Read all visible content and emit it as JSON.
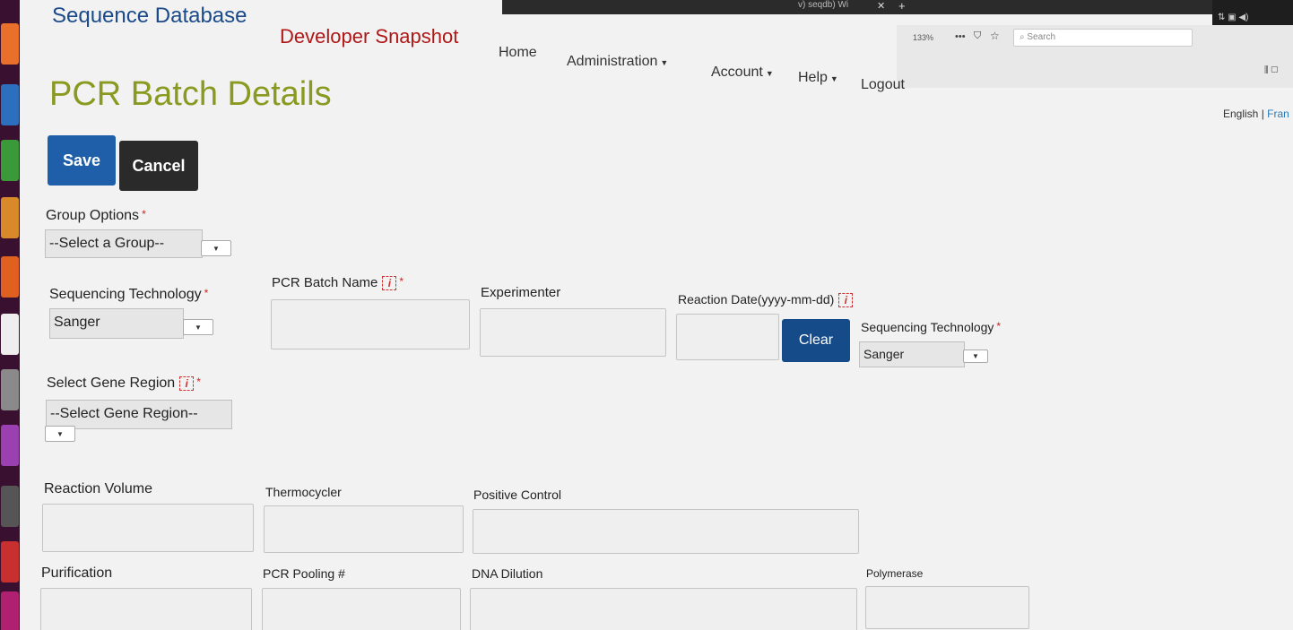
{
  "browser": {
    "tab_text": "v) seqdb) Wi",
    "zoom": "133%",
    "search_placeholder": "Search"
  },
  "nav": {
    "brand": "Sequence Database",
    "snapshot": "Developer Snapshot",
    "home": "Home",
    "administration": "Administration",
    "account": "Account",
    "help": "Help",
    "logout": "Logout",
    "lang_en": "English",
    "lang_sep": "|",
    "lang_fr": "Fran"
  },
  "page": {
    "title": "PCR Batch Details",
    "save": "Save",
    "cancel": "Cancel",
    "clear": "Clear"
  },
  "form": {
    "group_options": {
      "label": "Group Options",
      "value": "--Select a Group--"
    },
    "seq_tech": {
      "label": "Sequencing Technology",
      "value": "Sanger"
    },
    "pcr_batch_name": {
      "label": "PCR Batch Name",
      "value": ""
    },
    "experimenter": {
      "label": "Experimenter",
      "value": ""
    },
    "reaction_date": {
      "label": "Reaction Date(yyyy-mm-dd)",
      "value": ""
    },
    "seq_tech_2": {
      "label": "Sequencing Technology",
      "value": "Sanger"
    },
    "gene_region": {
      "label": "Select Gene Region",
      "value": "--Select Gene Region--"
    },
    "reaction_volume": {
      "label": "Reaction Volume",
      "value": ""
    },
    "thermocycler": {
      "label": "Thermocycler",
      "value": ""
    },
    "positive_control": {
      "label": "Positive Control",
      "value": ""
    },
    "purification": {
      "label": "Purification",
      "value": ""
    },
    "pcr_pooling": {
      "label": "PCR Pooling #",
      "value": ""
    },
    "dna_dilution": {
      "label": "DNA Dilution",
      "value": ""
    },
    "polymerase": {
      "label": "Polymerase",
      "value": ""
    },
    "required_mark": "*",
    "info_mark": "i"
  }
}
